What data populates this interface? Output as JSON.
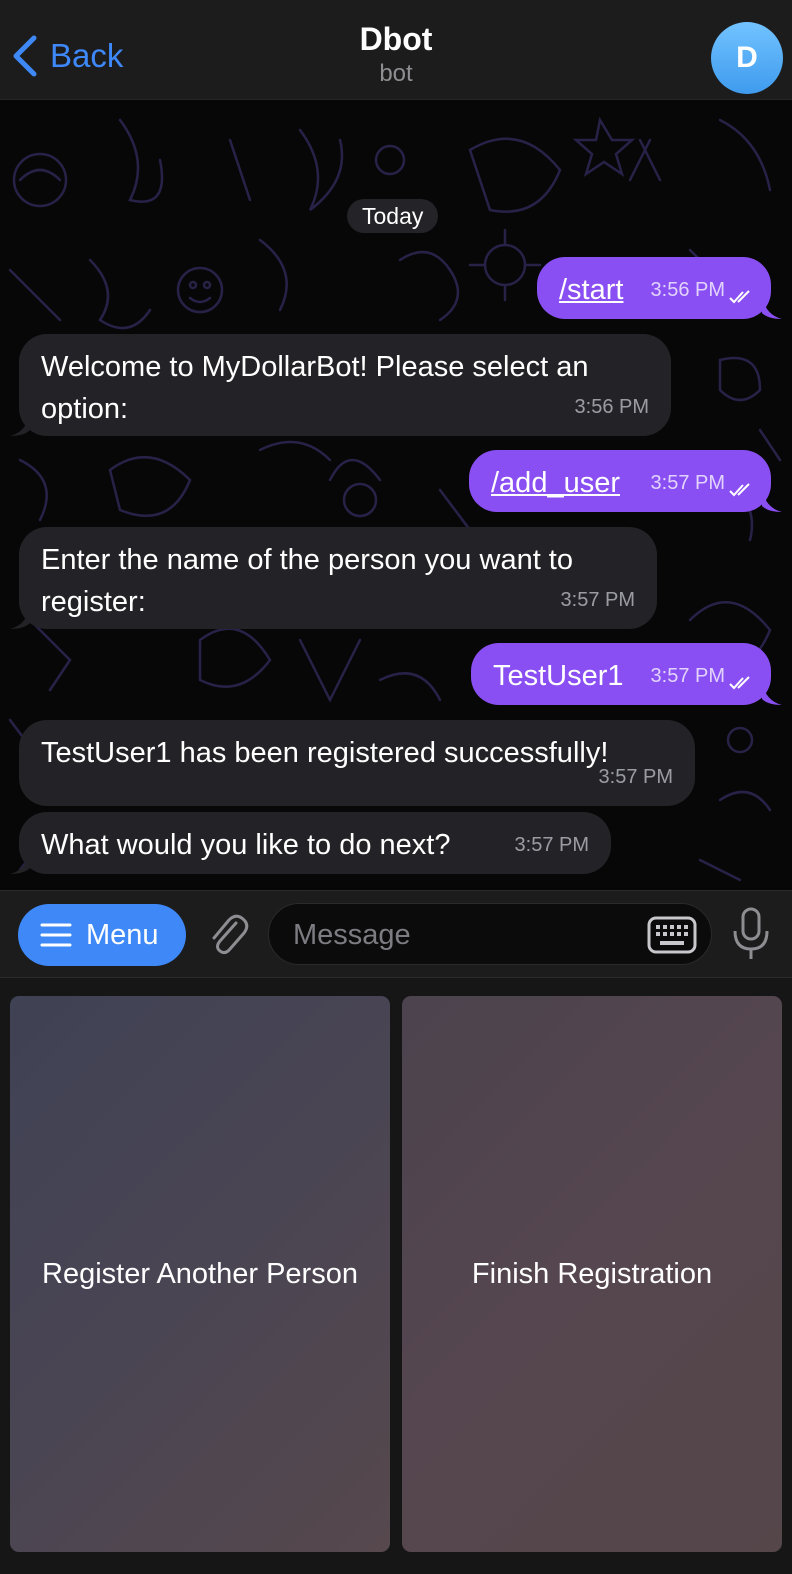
{
  "header": {
    "back_label": "Back",
    "title": "Dbot",
    "subtitle": "bot",
    "avatar_letter": "D",
    "accent_color": "#3e88f7"
  },
  "chat": {
    "date_chip": "Today",
    "messages": [
      {
        "direction": "outgoing",
        "text": "/start",
        "is_command": true,
        "time": "3:56 PM",
        "status": "read"
      },
      {
        "direction": "incoming",
        "text": "Welcome to MyDollarBot! Please select an option:",
        "time": "3:56 PM"
      },
      {
        "direction": "outgoing",
        "text": "/add_user",
        "is_command": true,
        "time": "3:57 PM",
        "status": "read"
      },
      {
        "direction": "incoming",
        "text": "Enter the name of the person you want to register:",
        "time": "3:57 PM"
      },
      {
        "direction": "outgoing",
        "text": "TestUser1",
        "is_command": false,
        "time": "3:57 PM",
        "status": "read"
      },
      {
        "direction": "incoming",
        "text": "TestUser1 has been registered successfully!",
        "time": "3:57 PM"
      },
      {
        "direction": "incoming",
        "text": "What would you like to do next?",
        "time": "3:57 PM"
      }
    ],
    "outgoing_bubble_color": "#8a4ff2",
    "incoming_bubble_color": "#232327"
  },
  "input_bar": {
    "menu_label": "Menu",
    "message_placeholder": "Message",
    "icons": [
      "menu-icon",
      "paperclip-icon",
      "keyboard-icon",
      "microphone-icon"
    ]
  },
  "reply_keyboard": {
    "buttons": [
      "Register Another Person",
      "Finish Registration"
    ]
  }
}
